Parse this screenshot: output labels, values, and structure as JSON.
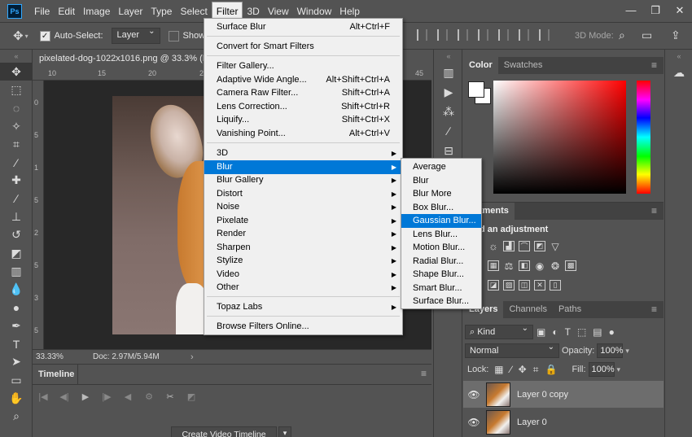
{
  "app": {
    "logo": "Ps",
    "menu": [
      "File",
      "Edit",
      "Image",
      "Layer",
      "Type",
      "Select",
      "Filter",
      "3D",
      "View",
      "Window",
      "Help"
    ],
    "window_controls": [
      "—",
      "❐",
      "✕"
    ]
  },
  "options": {
    "auto_select_label": "Auto-Select:",
    "auto_select_value": "Layer",
    "show_label": "Show",
    "mode_3d": "3D Mode:"
  },
  "document": {
    "tab_title": "pixelated-dog-1022x1016.png @ 33.3% (L",
    "ruler_top": [
      "10",
      "15",
      "20",
      "25",
      "30",
      "35",
      "40",
      "45"
    ],
    "ruler_left": [
      "0",
      "5",
      "1",
      "5",
      "2",
      "5",
      "3",
      "5"
    ],
    "zoom": "33.33%",
    "doc_size": "Doc: 2.97M/5.94M"
  },
  "timeline": {
    "tab": "Timeline",
    "create_button": "Create Video Timeline"
  },
  "filter_menu": {
    "items": [
      {
        "label": "Surface Blur",
        "shortcut": "Alt+Ctrl+F"
      },
      {
        "label": "Convert for Smart Filters",
        "shortcut": ""
      },
      {
        "label": "Filter Gallery...",
        "shortcut": ""
      },
      {
        "label": "Adaptive Wide Angle...",
        "shortcut": "Alt+Shift+Ctrl+A"
      },
      {
        "label": "Camera Raw Filter...",
        "shortcut": "Shift+Ctrl+A"
      },
      {
        "label": "Lens Correction...",
        "shortcut": "Shift+Ctrl+R"
      },
      {
        "label": "Liquify...",
        "shortcut": "Shift+Ctrl+X"
      },
      {
        "label": "Vanishing Point...",
        "shortcut": "Alt+Ctrl+V"
      },
      {
        "label": "3D",
        "shortcut": ""
      },
      {
        "label": "Blur",
        "shortcut": ""
      },
      {
        "label": "Blur Gallery",
        "shortcut": ""
      },
      {
        "label": "Distort",
        "shortcut": ""
      },
      {
        "label": "Noise",
        "shortcut": ""
      },
      {
        "label": "Pixelate",
        "shortcut": ""
      },
      {
        "label": "Render",
        "shortcut": ""
      },
      {
        "label": "Sharpen",
        "shortcut": ""
      },
      {
        "label": "Stylize",
        "shortcut": ""
      },
      {
        "label": "Video",
        "shortcut": ""
      },
      {
        "label": "Other",
        "shortcut": ""
      },
      {
        "label": "Topaz Labs",
        "shortcut": ""
      },
      {
        "label": "Browse Filters Online...",
        "shortcut": ""
      }
    ]
  },
  "blur_menu": {
    "items": [
      "Average",
      "Blur",
      "Blur More",
      "Box Blur...",
      "Gaussian Blur...",
      "Lens Blur...",
      "Motion Blur...",
      "Radial Blur...",
      "Shape Blur...",
      "Smart Blur...",
      "Surface Blur..."
    ]
  },
  "color_panel": {
    "tabs": [
      "Color",
      "Swatches"
    ]
  },
  "adjustments": {
    "tab": "ustments",
    "title": "d an adjustment"
  },
  "layers_panel": {
    "tabs": [
      "Layers",
      "Channels",
      "Paths"
    ],
    "kind": "Kind",
    "blend_mode": "Normal",
    "opacity_label": "Opacity:",
    "opacity": "100%",
    "lock_label": "Lock:",
    "fill_label": "Fill:",
    "fill": "100%",
    "layers": [
      "Layer 0 copy",
      "Layer 0"
    ]
  },
  "colors": {
    "menu_highlight": "#0078d7",
    "panel_bg": "#535353"
  }
}
